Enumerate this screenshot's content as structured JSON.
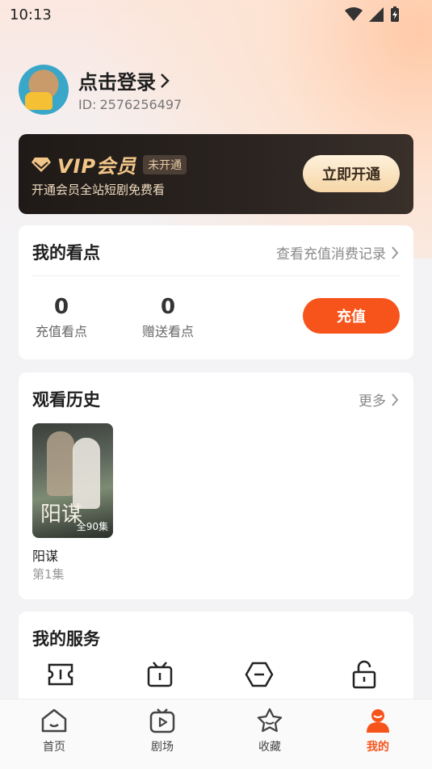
{
  "status_bar": {
    "time": "10:13"
  },
  "profile": {
    "login_text": "点击登录",
    "id_label": "ID:",
    "id_value": "2576256497"
  },
  "vip": {
    "title": "VIP会员",
    "status_badge": "未开通",
    "description": "开通会员全站短剧免费看",
    "open_button": "立即开通",
    "accent_color": "#f2c688"
  },
  "points_card": {
    "title": "我的看点",
    "records_link": "查看充值消费记录",
    "recharge_points": {
      "value": "0",
      "label": "充值看点"
    },
    "gift_points": {
      "value": "0",
      "label": "赠送看点"
    },
    "recharge_button": "充值",
    "accent_color": "#f7541b"
  },
  "history_card": {
    "title": "观看历史",
    "more_link": "更多",
    "items": [
      {
        "name": "阳谋",
        "episode": "第1集",
        "total": "全90集",
        "poster_text": "阳谋"
      }
    ]
  },
  "services_card": {
    "title": "我的服务",
    "icons": [
      "ticket-icon",
      "tv-icon",
      "minus-badge-icon",
      "unlock-icon"
    ]
  },
  "tab_bar": {
    "tabs": [
      {
        "label": "首页",
        "icon": "home-icon"
      },
      {
        "label": "剧场",
        "icon": "play-screen-icon"
      },
      {
        "label": "收藏",
        "icon": "star-icon"
      },
      {
        "label": "我的",
        "icon": "profile-icon",
        "active": true
      }
    ]
  }
}
